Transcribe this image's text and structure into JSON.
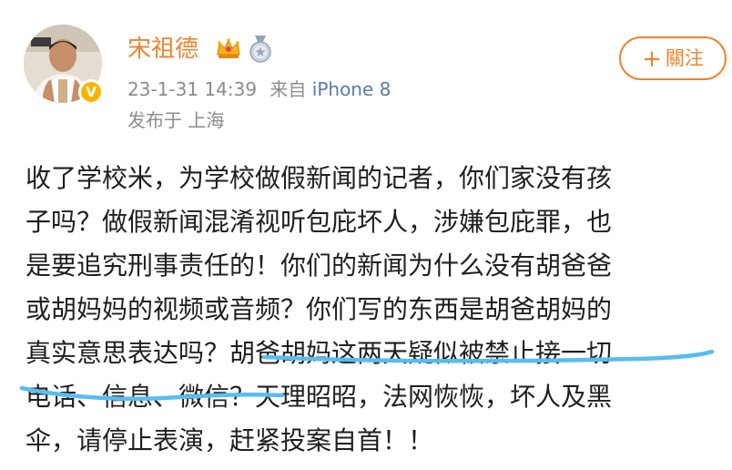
{
  "post": {
    "author": {
      "name": "宋祖德",
      "avatar_icon": "avatar-photo",
      "verified_badge_icon": "verified-v-badge-icon",
      "badges": [
        "crown-icon",
        "medal-icon"
      ]
    },
    "timestamp": "23-1-31 14:39",
    "source_prefix": "来自",
    "source_device": "iPhone 8",
    "location_label": "发布于 上海",
    "follow_button_label": "關注",
    "follow_button_icon": "plus-icon",
    "body_lines": [
      "收了学校米，为学校做假新闻的记者，你们家没有孩",
      "子吗？做假新闻混淆视听包庇坏人，涉嫌包庇罪，也",
      "是要追究刑事责任的！你们的新闻为什么没有胡爸爸",
      "或胡妈妈的视频或音频？你们写的东西是胡爸胡妈的",
      "真实意思表达吗？胡爸胡妈这两天疑似被禁止接一切",
      "电话、信息、微信？天理昭昭，法网恢恢，坏人及黑",
      "伞，请停止表演，赶紧投案自首！！"
    ],
    "highlight_annotation": {
      "color": "#57bdf0",
      "text": "胡爸胡妈这两天疑似被禁止接一切电话、信息、微信？"
    }
  },
  "colors": {
    "author_name": "#f0832d",
    "follow_button": "#f0832d",
    "meta_text": "#8c8c8c",
    "source_link": "#5b79a8",
    "body_text": "#1f1f1f"
  }
}
